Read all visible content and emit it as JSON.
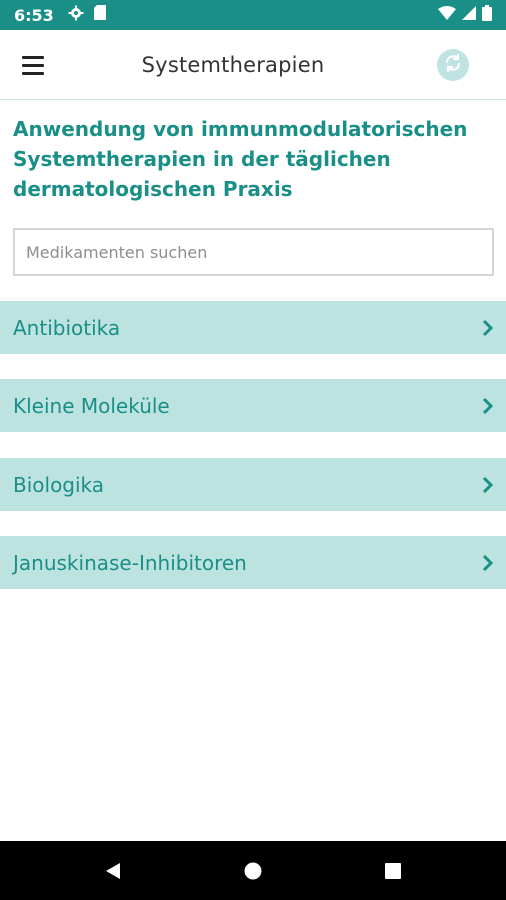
{
  "status_bar": {
    "time": "6:53",
    "icons": [
      "settings-icon",
      "sd-card-icon",
      "wifi-icon",
      "signal-icon",
      "battery-icon"
    ],
    "color": "#1a8f87"
  },
  "app_bar": {
    "title": "Systemtherapien",
    "menu_icon": "hamburger-menu-icon",
    "refresh_icon": "sync-icon"
  },
  "main": {
    "intro_title": "Anwendung von immunmodulatorischen Systemtherapien in der täglichen dermatologischen Praxis",
    "search": {
      "placeholder": "Medikamenten suchen",
      "value": ""
    },
    "categories": [
      {
        "label": "Antibiotika"
      },
      {
        "label": "Kleine Moleküle"
      },
      {
        "label": "Biologika"
      },
      {
        "label": "Januskinase-Inhibitoren"
      }
    ]
  },
  "nav_bar": {
    "buttons": [
      "back-icon",
      "home-icon",
      "recents-icon"
    ]
  },
  "colors": {
    "accent": "#1a8f87",
    "row_background": "#bde3e1"
  }
}
